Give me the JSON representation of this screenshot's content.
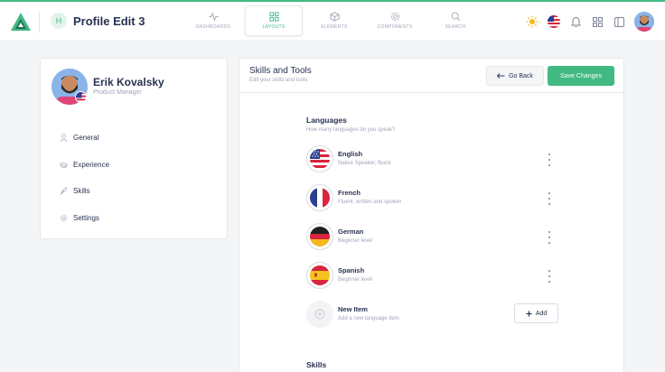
{
  "header": {
    "project_badge": "H",
    "project_title": "Profile Edit 3",
    "nav": [
      {
        "label": "DASHBOARDS",
        "icon": "activity-icon",
        "active": false
      },
      {
        "label": "LAYOUTS",
        "icon": "grid-icon",
        "active": true
      },
      {
        "label": "ELEMENTS",
        "icon": "box-icon",
        "active": false
      },
      {
        "label": "COMPONENTS",
        "icon": "gear-icon",
        "active": false
      },
      {
        "label": "SEARCH",
        "icon": "search-icon",
        "active": false
      }
    ],
    "right_icons": [
      "sun-icon",
      "us-flag-icon",
      "bell-icon",
      "apps-icon",
      "sidebar-icon",
      "user-avatar"
    ]
  },
  "profile": {
    "name": "Erik Kovalsky",
    "role": "Product Manager",
    "menu": [
      {
        "label": "General",
        "icon": "user-icon"
      },
      {
        "label": "Experience",
        "icon": "briefcase-icon"
      },
      {
        "label": "Skills",
        "icon": "feather-icon"
      },
      {
        "label": "Settings",
        "icon": "settings-icon"
      }
    ]
  },
  "main": {
    "title": "Skills and Tools",
    "subtitle": "Edit your skills and tools",
    "back_label": "Go Back",
    "save_label": "Save Changes",
    "languages": {
      "title": "Languages",
      "subtitle": "How many languages do you speak?",
      "items": [
        {
          "name": "English",
          "desc": "Native Speaker, fluent",
          "flag": "us-flag-icon"
        },
        {
          "name": "French",
          "desc": "Fluent, written and spoken",
          "flag": "fr-flag-icon"
        },
        {
          "name": "German",
          "desc": "Beginner level",
          "flag": "de-flag-icon"
        },
        {
          "name": "Spanish",
          "desc": "Beginner level",
          "flag": "es-flag-icon"
        }
      ],
      "new_item": {
        "name": "New Item",
        "desc": "Add a new language item",
        "add_label": "Add"
      }
    },
    "skills": {
      "title": "Skills"
    }
  },
  "colors": {
    "accent": "#41b983",
    "text": "#283252",
    "muted": "#a2a5b9"
  }
}
